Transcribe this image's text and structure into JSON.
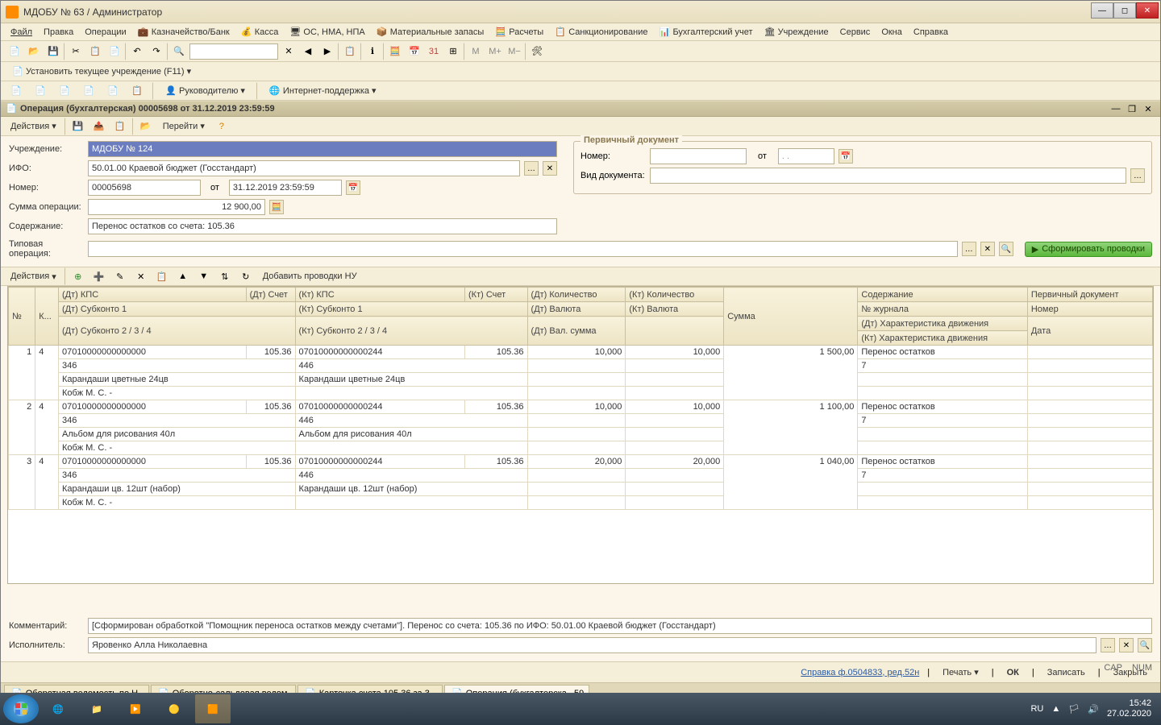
{
  "app": {
    "title": "МДОБУ № 63  / Администратор"
  },
  "menu": {
    "file": "Файл",
    "edit": "Правка",
    "operations": "Операции",
    "treasury": "Казначейство/Банк",
    "cash": "Касса",
    "os": "ОС, НМА, НПА",
    "materials": "Материальные запасы",
    "calculations": "Расчеты",
    "sanction": "Санкционирование",
    "accounting": "Бухгалтерский учет",
    "institution": "Учреждение",
    "service": "Сервис",
    "windows": "Окна",
    "help": "Справка"
  },
  "subbar": {
    "set_institution": "Установить текущее учреждение (F11)",
    "manager": "Руководителю",
    "support": "Интернет-поддержка"
  },
  "doc": {
    "title": "Операция (бухгалтерская) 00005698 от 31.12.2019 23:59:59",
    "actions": "Действия",
    "goto": "Перейти"
  },
  "form": {
    "institution_label": "Учреждение:",
    "institution_value": "МДОБУ № 124",
    "ifo_label": "ИФО:",
    "ifo_value": "50.01.00 Краевой бюджет (Госстандарт)",
    "number_label": "Номер:",
    "number_value": "00005698",
    "from": "от",
    "date_value": "31.12.2019 23:59:59",
    "sum_label": "Сумма операции:",
    "sum_value": "12 900,00",
    "content_label": "Содержание:",
    "content_value": "Перенос остатков со счета: 105.36",
    "type_label": "Типовая операция:"
  },
  "primary_doc": {
    "legend": "Первичный документ",
    "number_label": "Номер:",
    "from": "от",
    "type_label": "Вид документа:",
    "date_placeholder": ". ."
  },
  "table_toolbar": {
    "actions": "Действия",
    "add_nu": "Добавить проводки НУ",
    "form_entries": "Сформировать проводки"
  },
  "table_headers": {
    "n": "№",
    "k": "К...",
    "dt_kps": "(Дт) КПС",
    "dt_account": "(Дт) Счет",
    "kt_kps": "(Кт) КПС",
    "kt_account": "(Кт) Счет",
    "dt_qty": "(Дт) Количество",
    "kt_qty": "(Кт) Количество",
    "sum": "Сумма",
    "content": "Содержание",
    "primary": "Первичный документ",
    "dt_sub1": "(Дт) Субконто 1",
    "kt_sub1": "(Кт) Субконто 1",
    "dt_currency": "(Дт) Валюта",
    "kt_currency": "(Кт) Валюта",
    "journal": "№ журнала",
    "number": "Номер",
    "dt_sub234": "(Дт) Субконто 2 / 3 / 4",
    "kt_sub234": "(Кт) Субконто 2 / 3 / 4",
    "dt_val_sum": "(Дт) Вал. сумма",
    "dt_char": "(Дт) Характеристика движения",
    "date": "Дата",
    "kt_char": "(Кт) Характеристика движения"
  },
  "rows": [
    {
      "n": "1",
      "k": "4",
      "dt_kps": "07010000000000000",
      "dt_acc": "105.36",
      "kt_kps": "07010000000000244",
      "kt_acc": "105.36",
      "dt_qty": "10,000",
      "kt_qty": "10,000",
      "sum": "1 500,00",
      "content": "Перенос остатков",
      "journal": "7",
      "dt_sub1": "346",
      "kt_sub1": "446",
      "dt_sub2": "Карандаши цветные  24цв",
      "kt_sub2": "Карандаши цветные  24цв",
      "dt_sub3": "Кобж М. С. -"
    },
    {
      "n": "2",
      "k": "4",
      "dt_kps": "07010000000000000",
      "dt_acc": "105.36",
      "kt_kps": "07010000000000244",
      "kt_acc": "105.36",
      "dt_qty": "10,000",
      "kt_qty": "10,000",
      "sum": "1 100,00",
      "content": "Перенос остатков",
      "journal": "7",
      "dt_sub1": "346",
      "kt_sub1": "446",
      "dt_sub2": "Альбом для рисования 40л",
      "kt_sub2": "Альбом для рисования 40л",
      "dt_sub3": "Кобж М. С. -"
    },
    {
      "n": "3",
      "k": "4",
      "dt_kps": "07010000000000000",
      "dt_acc": "105.36",
      "kt_kps": "07010000000000244",
      "kt_acc": "105.36",
      "dt_qty": "20,000",
      "kt_qty": "20,000",
      "sum": "1 040,00",
      "content": "Перенос остатков",
      "journal": "7",
      "dt_sub1": "346",
      "kt_sub1": "446",
      "dt_sub2": "Карандаши цв. 12шт (набор)",
      "kt_sub2": "Карандаши цв. 12шт (набор)",
      "dt_sub3": "Кобж М. С. -"
    }
  ],
  "footer_form": {
    "comment_label": "Комментарий:",
    "comment_value": "[Сформирован обработкой \"Помощник переноса остатков между счетами\"]. Перенос со счета: 105.36 по ИФО: 50.01.00 Краевой бюджет (Госстандарт)",
    "executor_label": "Исполнитель:",
    "executor_value": "Яровенко Алла Николаевна"
  },
  "bottom": {
    "reference": "Справка ф.0504833, ред.52н",
    "print": "Печать",
    "ok": "ОК",
    "save": "Записать",
    "close": "Закрыть"
  },
  "tabs": [
    "Оборотная ведомость по Н...",
    "Оборотно-сальдовая ведом...",
    "Карточка счета 105.36 за 3...",
    "Операция (бухгалтерска...59"
  ],
  "tray": {
    "lang": "RU",
    "cap": "CAP",
    "num": "NUM",
    "time": "15:42",
    "date": "27.02.2020"
  }
}
